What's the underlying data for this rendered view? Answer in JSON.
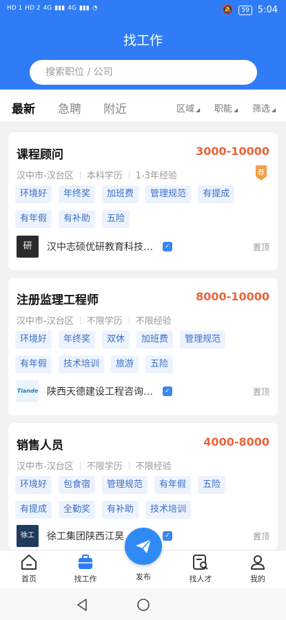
{
  "status_bar": {
    "left_labels": [
      "HD 1",
      "HD 2",
      "4G",
      "4G"
    ],
    "battery": "59",
    "time": "5:04"
  },
  "header": {
    "title": "找工作"
  },
  "search": {
    "placeholder": "搜索职位 / 公司"
  },
  "tabs": [
    {
      "label": "最新",
      "active": true
    },
    {
      "label": "急聘",
      "active": false
    },
    {
      "label": "附近",
      "active": false
    }
  ],
  "filters": [
    {
      "label": "区域"
    },
    {
      "label": "职能"
    },
    {
      "label": "筛选"
    }
  ],
  "jobs": [
    {
      "title": "课程顾问",
      "salary": "3000-10000",
      "meta": [
        "汉中市-汉台区",
        "本科学历",
        "1-3年经验"
      ],
      "badge": "荐",
      "tags": [
        "环境好",
        "年终奖",
        "加班费",
        "管理规范",
        "有提成",
        "有年假",
        "有补助",
        "五险"
      ],
      "company": "汉中志硕优研教育科技有限公司",
      "pin": "置顶",
      "logo": "研"
    },
    {
      "title": "注册监理工程师",
      "salary": "8000-10000",
      "meta": [
        "汉中市-汉台区",
        "不限学历",
        "不限经验"
      ],
      "tags": [
        "环境好",
        "年终奖",
        "双休",
        "加班费",
        "管理规范",
        "有年假",
        "技术培训",
        "旅游",
        "五险"
      ],
      "company": "陕西天德建设工程咨询有限公司",
      "pin": "置顶",
      "logo": "Tiande"
    },
    {
      "title": "销售人员",
      "salary": "4000-8000",
      "meta": [
        "汉中市-汉台区",
        "不限学历",
        "不限经验"
      ],
      "tags": [
        "环境好",
        "包食宿",
        "管理规范",
        "有年假",
        "五险",
        "有提成",
        "全勤奖",
        "有补助",
        "技术培训"
      ],
      "company": "徐工集团陕西江昊",
      "pin": "置顶",
      "logo": "徐工"
    }
  ],
  "bottom_nav": [
    {
      "label": "首页",
      "icon": "home-icon"
    },
    {
      "label": "找工作",
      "icon": "briefcase-icon",
      "active": true
    },
    {
      "label": "发布",
      "icon": "paper-plane-icon"
    },
    {
      "label": "找人才",
      "icon": "talent-search-icon"
    },
    {
      "label": "我的",
      "icon": "user-icon"
    }
  ],
  "colors": {
    "primary": "#2f7cf6",
    "salary": "#e8643c",
    "tag_bg": "#edf3fe",
    "tag_text": "#3a6fc4"
  }
}
